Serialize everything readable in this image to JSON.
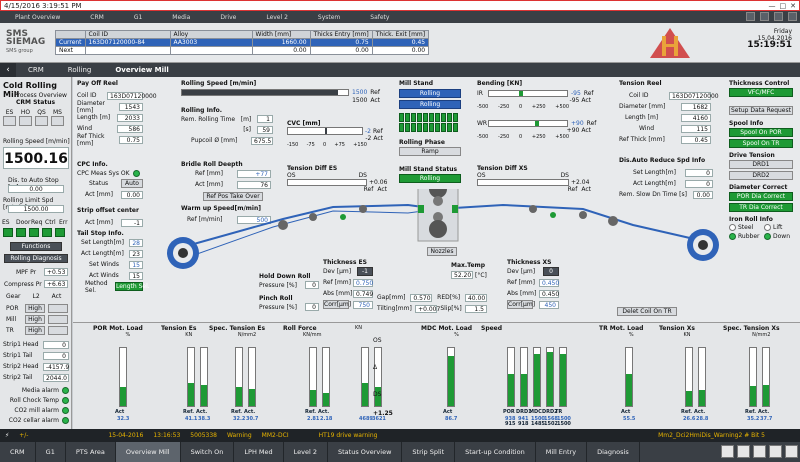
{
  "titlebar": {
    "datetime": "4/15/2016 3:19:51 PM"
  },
  "topnav": [
    "Plant Overview",
    "CRM",
    "G1",
    "Media",
    "Drive",
    "Level 2",
    "System",
    "Safety"
  ],
  "header": {
    "logo_line1": "SMS",
    "logo_line2": "SIEMAG",
    "logo_sub": "SMS group",
    "coil_table": {
      "columns": [
        "",
        "Coil ID",
        "Alloy",
        "Width [mm]",
        "Thicks Entry [mm]",
        "Thick. Exit [mm]"
      ],
      "current": [
        "Current",
        "163D07120000-84",
        "AA3003",
        "1660.00",
        "0.75",
        "0.45"
      ],
      "next": [
        "Next",
        "",
        "",
        "0.00",
        "0.00",
        "0.00"
      ]
    },
    "day": "Friday",
    "date": "15.04.2016",
    "time": "15:19:51"
  },
  "breadcrumb": [
    "CRM",
    "Rolling",
    "Overview Mill"
  ],
  "left": {
    "title": "Cold Rolling Mill",
    "subtitle": "Process Overview",
    "status_title": "CRM Status",
    "status_buttons": [
      "ES",
      "HO",
      "QS",
      "MS"
    ],
    "speed_label": "Rolling Speed [m/min]",
    "speed_value": "1500.16",
    "dist_label": "Dis. to Auto Stop [m]",
    "dist_value": "0.00",
    "limit_label": "Rolling Limit Spd [m/min]",
    "limit_value": "1500.00",
    "es_labels": [
      "ES",
      "Door",
      "Req",
      "Ctrl",
      "Err"
    ],
    "functions": "Functions",
    "diag": "Rolling Diagnosis",
    "mpf_label": "MPF Pr",
    "mpf_value": "+0.53",
    "comp_label": "Compress Pr",
    "comp_value": "+6.63",
    "gear_label": "Gear",
    "gear_l2": "L2",
    "gear_act": "Act",
    "gear_rows": [
      {
        "name": "POR",
        "v": "High"
      },
      {
        "name": "Mill",
        "v": "High"
      },
      {
        "name": "TR",
        "v": "High"
      }
    ],
    "strip": [
      {
        "name": "Strip1 Head",
        "v": "0"
      },
      {
        "name": "Strip1 Tail",
        "v": "0"
      },
      {
        "name": "Strip2 Head",
        "v": "-4157.9"
      },
      {
        "name": "Strip2 Tail",
        "v": "2044.0"
      }
    ],
    "alarms": [
      "Media alarm",
      "Roll Chock Temp",
      "CO2 mill alarm",
      "CO2 cellar alarm"
    ]
  },
  "payoff": {
    "title": "Pay Off Reel",
    "rows": [
      {
        "k": "Coil ID",
        "v": "163D07120000"
      },
      {
        "k": "Diameter [mm]",
        "v": "1543"
      },
      {
        "k": "Length [m]",
        "v": "2033"
      },
      {
        "k": "Wind",
        "v": "586"
      },
      {
        "k": "Ref Thick [mm]",
        "v": "0.75"
      }
    ]
  },
  "cpc": {
    "title": "CPC Info.",
    "meas": "CPC Meas Sys OK",
    "status_label": "Status",
    "status_value": "Auto",
    "act_label": "Act [mm]",
    "act_value": "0.00"
  },
  "offset": {
    "title": "Strip offset center",
    "act_label": "Act [mm]",
    "act_value": "-1"
  },
  "tailstop": {
    "title": "Tail Stop Info.",
    "rows": [
      {
        "k": "Set Length[m]",
        "v": "28"
      },
      {
        "k": "Act Length[m]",
        "v": "23"
      },
      {
        "k": "Set Winds",
        "v": "15"
      },
      {
        "k": "Act Winds",
        "v": "15"
      }
    ],
    "method_label": "Method Sel.",
    "method_value": "Length Sel."
  },
  "rolling_speed": {
    "title": "Rolling Speed [m/min]",
    "value": "1500",
    "ref": "1500",
    "ref_label": "Ref",
    "act_label": "Act",
    "fill": 0.94
  },
  "rolling_info": {
    "title": "Rolling Info.",
    "remtime_label": "Rem. Rolling Time",
    "unit_m": "[m]",
    "unit_s": "[s]",
    "remtime_value": "1",
    "s_value": "59",
    "pupcoil_label": "Pupcoil Ø [mm]",
    "pupcoil_value": "675.5"
  },
  "bridle": {
    "title": "Bridle Roll Deepth",
    "ref_label": "Ref [mm]",
    "ref_value": "+77",
    "act_label": "Act [mm]",
    "act_value": "76",
    "btn": "Ref Pos Take Over"
  },
  "warmup": {
    "title": "Warm up Speed[m/min]",
    "ref_label": "Ref [m/min]",
    "ref_value": "500"
  },
  "cvc": {
    "title": "CVC [mm]",
    "v1": "-2",
    "v2": "-2",
    "ref": "Ref",
    "act": "Act",
    "ticks": [
      "-150",
      "-75",
      "0",
      "+75",
      "+150"
    ]
  },
  "tension_diff_es": {
    "title": "Tension Diff ES",
    "os": "OS",
    "ds": "DS",
    "value": "+0.06",
    "ref": "Ref",
    "act": "Act"
  },
  "mill_stand": {
    "title": "Mill Stand",
    "mode": "Rolling",
    "btn": "Rolling",
    "phase_title": "Rolling Phase",
    "phase_value": "Ramp",
    "status_title": "Mill Stand Status",
    "status_value": "Rolling"
  },
  "bending": {
    "title": "Bending [KN]",
    "ir": "IR",
    "wr": "WR",
    "ir_v1": "-95",
    "ir_v2": "-95",
    "wr_v1": "+90",
    "wr_v2": "+90",
    "ticks": [
      "-500",
      "-250",
      "0",
      "+250",
      "+500"
    ],
    "ref": "Ref",
    "act": "Act"
  },
  "tension_diff_xs": {
    "title": "Tension Diff XS",
    "os": "OS",
    "ds": "DS",
    "value": "+2.04",
    "ref": "Ref",
    "act": "Act"
  },
  "tension_reel": {
    "title": "Tension Reel",
    "rows": [
      {
        "k": "Coil ID",
        "v": "163D07120000"
      },
      {
        "k": "Diameter [mm]",
        "v": "1682"
      },
      {
        "k": "Length [m]",
        "v": "4160"
      },
      {
        "k": "Wind",
        "v": "115"
      },
      {
        "k": "Ref Thick [mm]",
        "v": "0.45"
      }
    ]
  },
  "auto_reduce": {
    "title": "Dis.Auto Reduce Spd Info",
    "set_label": "Set Length[m]",
    "set_value": "0",
    "act_label": "Act Length[m]",
    "act_value": "0",
    "rem_label": "Rem. Slow Dn Time [s]",
    "rem_value": "0.00"
  },
  "thickness_control": {
    "title": "Thickness Control",
    "value": "VFC/MFC",
    "setup": "Setup Data Request"
  },
  "spool": {
    "title": "Spool Info",
    "b1": "Spool On POR",
    "b2": "Spool On TR"
  },
  "drive_tension": {
    "title": "Drive Tension",
    "d1": "DRD1",
    "d2": "DRD2"
  },
  "diameter_correct": {
    "title": "Diameter Correct",
    "b1": "POR Dia Correct",
    "b2": "TR Dia Correct"
  },
  "iron_roll": {
    "title": "Iron Roll Info",
    "steel": "Steel",
    "lift": "Lift",
    "rubber": "Rubber",
    "down": "Down"
  },
  "hold_down": {
    "title": "Hold Down Roll",
    "pressure_label": "Pressure [%]",
    "pressure_value": "0"
  },
  "pinch": {
    "title": "Pinch Roll",
    "pressure_label": "Pressure [%]",
    "pressure_value": "0"
  },
  "thickness_es": {
    "title": "Thickness ES",
    "dev_label": "Dev [µm]",
    "dev_value": "-1",
    "ref_label": "Ref [mm]",
    "ref_value": "0.750",
    "abs_label": "Abs [mm]",
    "abs_value": "0.749",
    "corr_label": "Corr[µm]",
    "corr_value": "750"
  },
  "gap": {
    "gap_label": "Gap[mm]",
    "gap_value": "0.570",
    "tilt_label": "Tilting[mm]",
    "tilt_value": "+0.007",
    "red_label": "RED[%]",
    "red_value": "40.00",
    "slip_label": "Slip[%]",
    "slip_value": "1.5"
  },
  "nozzles": "Nozzles",
  "maxtemp": {
    "title": "Max.Temp",
    "value": "52.20",
    "unit": "[°C]"
  },
  "thickness_xs": {
    "title": "Thickness XS",
    "dev_label": "Dev [µm]",
    "dev_value": "0",
    "ref_label": "Ref [mm]",
    "ref_value": "0.450",
    "abs_label": "Abs [mm]",
    "abs_value": "0.450",
    "corr_label": "Corr[µm]",
    "corr_value": "450"
  },
  "delet_coil": "Delet Coil On TR",
  "gauges": [
    {
      "title": "POR Mot. Load",
      "unit": "%",
      "bars": [
        {
          "label": "Act",
          "value": "32.3",
          "fill": 0.32
        }
      ]
    },
    {
      "title": "Tension Es",
      "unit": "KN",
      "bars": [
        {
          "label": "Ref.",
          "value": "41.1",
          "fill": 0.4
        },
        {
          "label": "Act.",
          "value": "38.3",
          "fill": 0.37
        }
      ]
    },
    {
      "title": "Spec. Tension Es",
      "unit": "N/mm2",
      "bars": [
        {
          "label": "Ref.",
          "value": "32.2",
          "fill": 0.32
        },
        {
          "label": "Act.",
          "value": "30.7",
          "fill": 0.3
        }
      ]
    },
    {
      "title": "Roll Force",
      "unit": "KN/mm",
      "bars": [
        {
          "label": "Ref.",
          "value": "2.81",
          "fill": 0.28
        },
        {
          "label": "Act.",
          "value": "2.18",
          "fill": 0.22
        }
      ]
    },
    {
      "title": "",
      "unit": "KN",
      "bars": [
        {
          "label": "",
          "value": "4689",
          "fill": 0.4
        },
        {
          "label": "",
          "value": "3621",
          "fill": 0.32
        }
      ]
    },
    {
      "title": "MDC Mot. Load",
      "unit": "%",
      "bars": [
        {
          "label": "Act",
          "value": "86.7",
          "fill": 0.86
        }
      ]
    },
    {
      "title": "Speed",
      "unit": "",
      "bars": [
        {
          "label": "POR",
          "value": "938",
          "fill": 0.55
        },
        {
          "label": "DRD1",
          "value": "941",
          "fill": 0.55
        },
        {
          "label": "MDC",
          "value": "1500",
          "fill": 0.9
        },
        {
          "label": "DRD2",
          "value": "1568",
          "fill": 0.93
        },
        {
          "label": "TR",
          "value": "1500",
          "fill": 0.9
        }
      ]
    },
    {
      "title": "TR Mot. Load",
      "unit": "%",
      "bars": [
        {
          "label": "Act",
          "value": "55.5",
          "fill": 0.55
        }
      ]
    },
    {
      "title": "Tension Xs",
      "unit": "KN",
      "bars": [
        {
          "label": "Ref.",
          "value": "26.6",
          "fill": 0.26
        },
        {
          "label": "Act.",
          "value": "28.8",
          "fill": 0.28
        }
      ]
    },
    {
      "title": "Spec. Tension Xs",
      "unit": "N/mm2",
      "bars": [
        {
          "label": "Ref.",
          "value": "35.2",
          "fill": 0.35
        },
        {
          "label": "Act.",
          "value": "37.7",
          "fill": 0.37
        }
      ]
    }
  ],
  "roll_force_extra": {
    "os": "OS",
    "delta": "Δ",
    "ds": "DS",
    "act_value": "+1.25"
  },
  "speed_ref_values": [
    "915",
    "918",
    "1485",
    "1502",
    "1500"
  ],
  "alarm_bar": {
    "flag": "+/-",
    "date": "15-04-2016",
    "time": "13:16:53",
    "id": "5005338",
    "type": "Warning",
    "source": "MM2-DCI",
    "text": "HT19 drive warning",
    "extra": "Mm2_Dci2HmiDis_Warning2 # Bit 5"
  },
  "botnav": [
    "CRM",
    "G1",
    "PTS Area",
    "Overview Mill",
    "Switch On",
    "LPH Med",
    "Level 2",
    "Status Overview",
    "Strip Split",
    "Start-up Condition",
    "Mill Entry",
    "Diagnosis"
  ]
}
